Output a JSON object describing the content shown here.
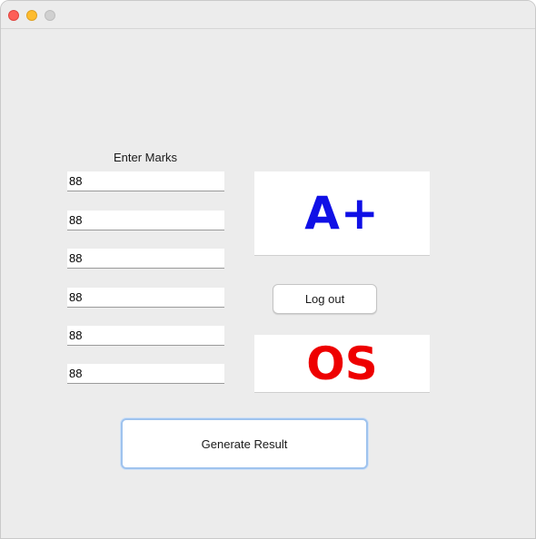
{
  "window": {
    "controls": [
      "close",
      "minimize",
      "maximize"
    ]
  },
  "marks": {
    "label": "Enter Marks",
    "fields": [
      "88",
      "88",
      "88",
      "88",
      "88",
      "88"
    ]
  },
  "result": {
    "grade": "A+",
    "grade_color": "#1010e6",
    "subject_code": "OS",
    "subject_color": "#ee0000"
  },
  "buttons": {
    "logout_label": "Log out",
    "generate_label": "Generate Result"
  }
}
